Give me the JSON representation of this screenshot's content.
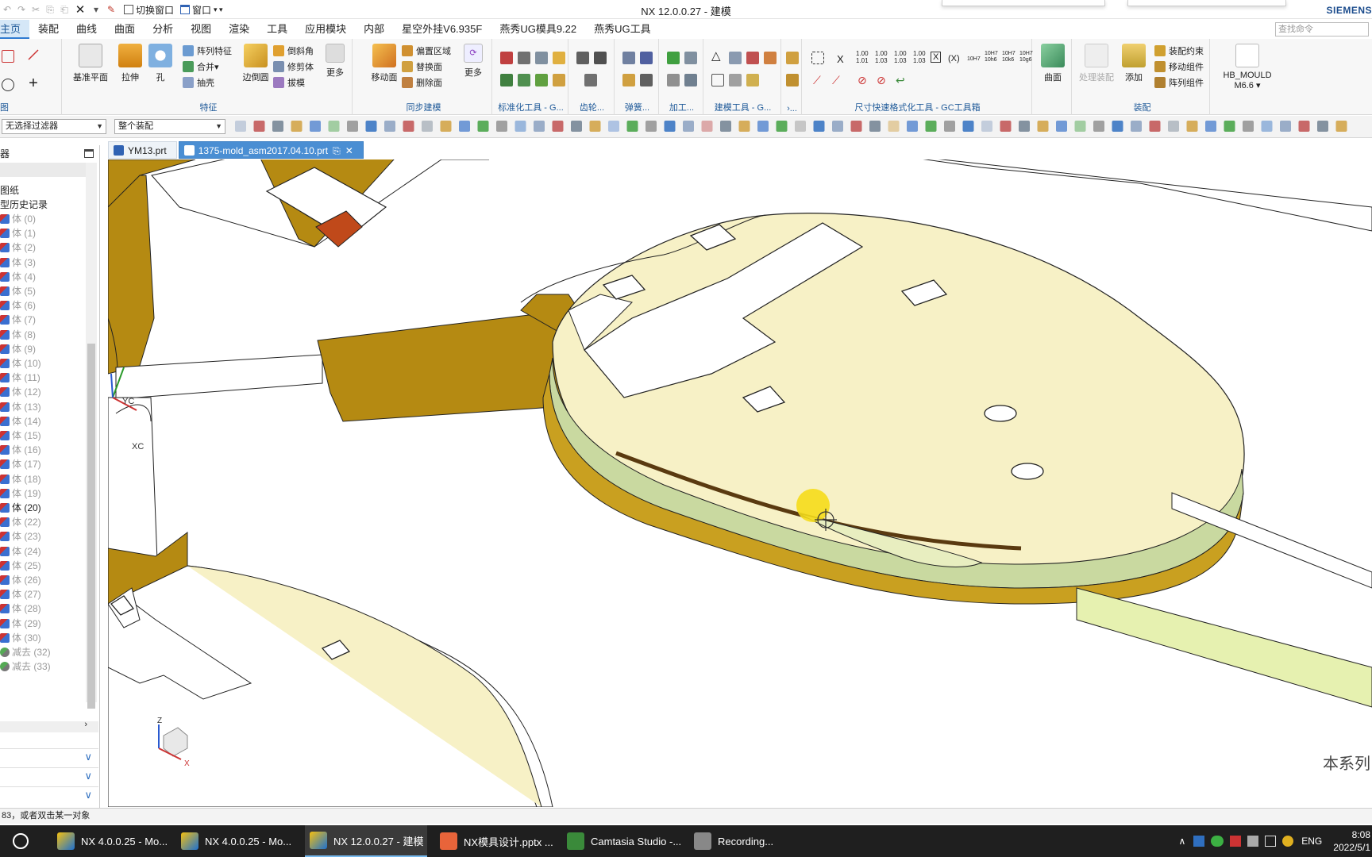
{
  "app": {
    "window_title": "NX 12.0.0.27 - 建模",
    "brand": "SIEMENS",
    "quick_access": {
      "switch_window": "切换窗口",
      "window": "窗口"
    }
  },
  "menu_tabs": [
    "主页",
    "装配",
    "曲线",
    "曲面",
    "分析",
    "视图",
    "渲染",
    "工具",
    "应用模块",
    "内部",
    "星空外挂V6.935F",
    "燕秀UG模具9.22",
    "燕秀UG工具"
  ],
  "command_search_placeholder": "查找命令",
  "ribbon": {
    "feature": {
      "label": "特征",
      "datum": "基准平面",
      "extrude": "拉伸",
      "hole": "孔",
      "pattern": "阵列特征",
      "unite": "合并",
      "shell": "抽壳",
      "edge_blend": "边倒圆",
      "chamfer": "倒斜角",
      "trim_body": "修剪体",
      "draft": "拔模",
      "more": "更多"
    },
    "sync": {
      "label": "同步建模",
      "move_face": "移动面",
      "offset_region": "偏置区域",
      "replace_face": "替换面",
      "delete_face": "删除面",
      "more": "更多"
    },
    "std_tools": {
      "label": "标准化工具 - G..."
    },
    "gear": {
      "label": "齿轮..."
    },
    "spring": {
      "label": "弹簧..."
    },
    "machining": {
      "label": "加工..."
    },
    "modeling_tools": {
      "label": "建模工具 - G..."
    },
    "misc": {
      "label": "›..."
    },
    "dimension": {
      "label": "尺寸快速格式化工具 - GC工具箱",
      "x": "X",
      "paren_x": "(X)",
      "tol": [
        "1.00\n1.01",
        "1.00\n1.03",
        "1.00\n1.03",
        "1.00\n1.03"
      ],
      "fits": [
        "10H7",
        "10H7\n10h6",
        "10H7\n10k6",
        "10H7\n10g6"
      ]
    },
    "surface": {
      "label": "曲面",
      "btn": "曲面"
    },
    "assembly": {
      "label": "装配",
      "process_assy": "处理装配",
      "add": "添加",
      "constraint": "装配约束",
      "move_component": "移动组件",
      "pattern_component": "阵列组件"
    },
    "hb_mould": {
      "line1": "HB_MOULD",
      "line2": "M6.6"
    }
  },
  "selection_bar": {
    "filter": "无选择过滤器",
    "scope": "整个装配"
  },
  "navigator": {
    "header_label": "器",
    "top_items": [
      "图纸",
      "型历史记录"
    ],
    "items": [
      {
        "label": "体 (0)",
        "dim": true
      },
      {
        "label": "体 (1)",
        "dim": true
      },
      {
        "label": "体 (2)",
        "dim": true
      },
      {
        "label": "体 (3)",
        "dim": true
      },
      {
        "label": "体 (4)",
        "dim": true
      },
      {
        "label": "体 (5)",
        "dim": true
      },
      {
        "label": "体 (6)",
        "dim": true
      },
      {
        "label": "体 (7)",
        "dim": true
      },
      {
        "label": "体 (8)",
        "dim": true
      },
      {
        "label": "体 (9)",
        "dim": true
      },
      {
        "label": "体 (10)",
        "dim": true
      },
      {
        "label": "体 (11)",
        "dim": true
      },
      {
        "label": "体 (12)",
        "dim": true
      },
      {
        "label": "体 (13)",
        "dim": true
      },
      {
        "label": "体 (14)",
        "dim": true
      },
      {
        "label": "体 (15)",
        "dim": true
      },
      {
        "label": "体 (16)",
        "dim": true
      },
      {
        "label": "体 (17)",
        "dim": true
      },
      {
        "label": "体 (18)",
        "dim": true
      },
      {
        "label": "体 (19)",
        "dim": true
      },
      {
        "label": "体 (20)",
        "dim": false
      },
      {
        "label": "体 (22)",
        "dim": true
      },
      {
        "label": "体 (23)",
        "dim": true
      },
      {
        "label": "体 (24)",
        "dim": true
      },
      {
        "label": "体 (25)",
        "dim": true
      },
      {
        "label": "体 (26)",
        "dim": true
      },
      {
        "label": "体 (27)",
        "dim": true
      },
      {
        "label": "体 (28)",
        "dim": true
      },
      {
        "label": "体 (29)",
        "dim": true
      },
      {
        "label": "体 (30)",
        "dim": true
      },
      {
        "label": "减去 (32)",
        "dim": true
      },
      {
        "label": "减去 (33)",
        "dim": true
      }
    ]
  },
  "doc_tabs": [
    {
      "label": "YM13.prt",
      "active": false
    },
    {
      "label": "1375-mold_asm2017.04.10.prt",
      "active": true
    }
  ],
  "viewport": {
    "axis_labels": {
      "yc": "YC",
      "xc": "XC",
      "z": "Z",
      "x": "X"
    },
    "watermark": "本系列"
  },
  "status_text": "83，或者双击某一对象",
  "taskbar": {
    "items": [
      {
        "label": "NX 4.0.0.25 - Mo...",
        "active": false
      },
      {
        "label": "NX 4.0.0.25 - Mo...",
        "active": false
      },
      {
        "label": "NX 12.0.0.27 - 建模",
        "active": true
      },
      {
        "label": "NX模具设计.pptx ...",
        "active": false
      },
      {
        "label": "Camtasia Studio -...",
        "active": false
      },
      {
        "label": "Recording...",
        "active": false
      }
    ],
    "lang": "ENG",
    "time": "8:08",
    "date": "2022/5/1"
  },
  "colors": {
    "accent": "#2f7bd1",
    "ribbon_label": "#1f5a99",
    "mold_gold": "#b8860b",
    "mold_cream": "#fbf7cf",
    "mold_green": "#c9d9a0"
  }
}
